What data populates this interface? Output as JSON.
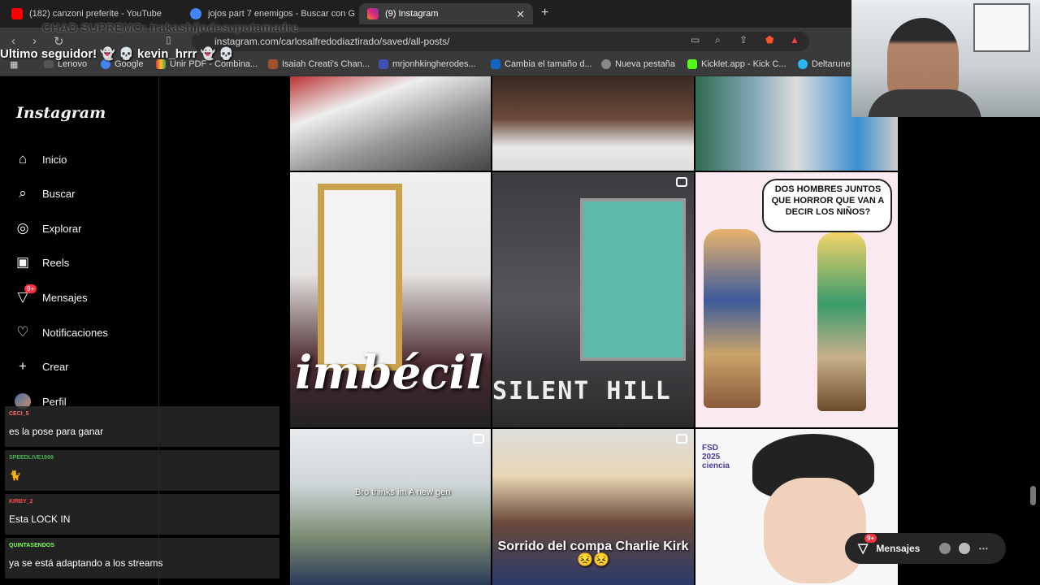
{
  "browser": {
    "tabs": [
      {
        "title": "(182) canzoni preferite - YouTube",
        "favicon_color": "#ff0000"
      },
      {
        "title": "jojos part 7 enemigos - Buscar con G",
        "favicon_color": "#4285f4"
      },
      {
        "title": "(9) Instagram",
        "favicon_color": "#e1306c",
        "active": true
      }
    ],
    "url": "instagram.com/carlosalfredodiaztirado/saved/all-posts/",
    "bookmarks": [
      "Lenovo",
      "Google",
      "Unir PDF - Combina...",
      "Isaiah Creati's Chan...",
      "mrjonhkingherodes...",
      "Cambia el tamaño d...",
      "Nueva pestaña",
      "Kicklet.app - Kick C...",
      "Deltarune"
    ]
  },
  "stream_overlay": {
    "top_banner": "CHAD SUPREMO: trakashijodesuputamadre",
    "follower_alert": "Ultimo seguidor! 👻 💀 kevin_hrrr 👻 💀"
  },
  "instagram": {
    "logo": "Instagram",
    "nav": [
      {
        "label": "Inicio",
        "icon": "home-icon"
      },
      {
        "label": "Buscar",
        "icon": "search-icon"
      },
      {
        "label": "Explorar",
        "icon": "compass-icon"
      },
      {
        "label": "Reels",
        "icon": "reels-icon"
      },
      {
        "label": "Mensajes",
        "icon": "messenger-icon",
        "badge": "9+"
      },
      {
        "label": "Notificaciones",
        "icon": "heart-icon"
      },
      {
        "label": "Crear",
        "icon": "plus-icon"
      },
      {
        "label": "Perfil",
        "icon": "avatar"
      }
    ],
    "posts": [
      {
        "caption": "imbécil"
      },
      {
        "caption": "SILENT HILL"
      },
      {
        "caption": "DOS HOMBRES JUNTOS QUE HORROR QUE VAN A DECIR LOS NIÑOS?"
      },
      {
        "caption": "Bro thinks im A new gen"
      },
      {
        "caption": "Sorrido del compa Charlie Kirk 😣😣"
      },
      {
        "caption": "FSD 2025 ciencia"
      }
    ],
    "dm_pill": {
      "label": "Mensajes",
      "badge": "9+"
    }
  },
  "chat": [
    {
      "user": "CECI_5",
      "message": "es la pose para ganar",
      "color": "#ff6b6b"
    },
    {
      "user": "SPEEDLIVE1999",
      "message": "🐈",
      "color": "#4caf50"
    },
    {
      "user": "KIRBY_2",
      "message": "Esta LOCK IN",
      "color": "#ff4d4d"
    },
    {
      "user": "QUINTASENDOS",
      "message": "ya se está adaptando a los streams",
      "color": "#7cff5a"
    }
  ],
  "colors": {
    "accent": "#ff3040",
    "background": "#000000"
  }
}
